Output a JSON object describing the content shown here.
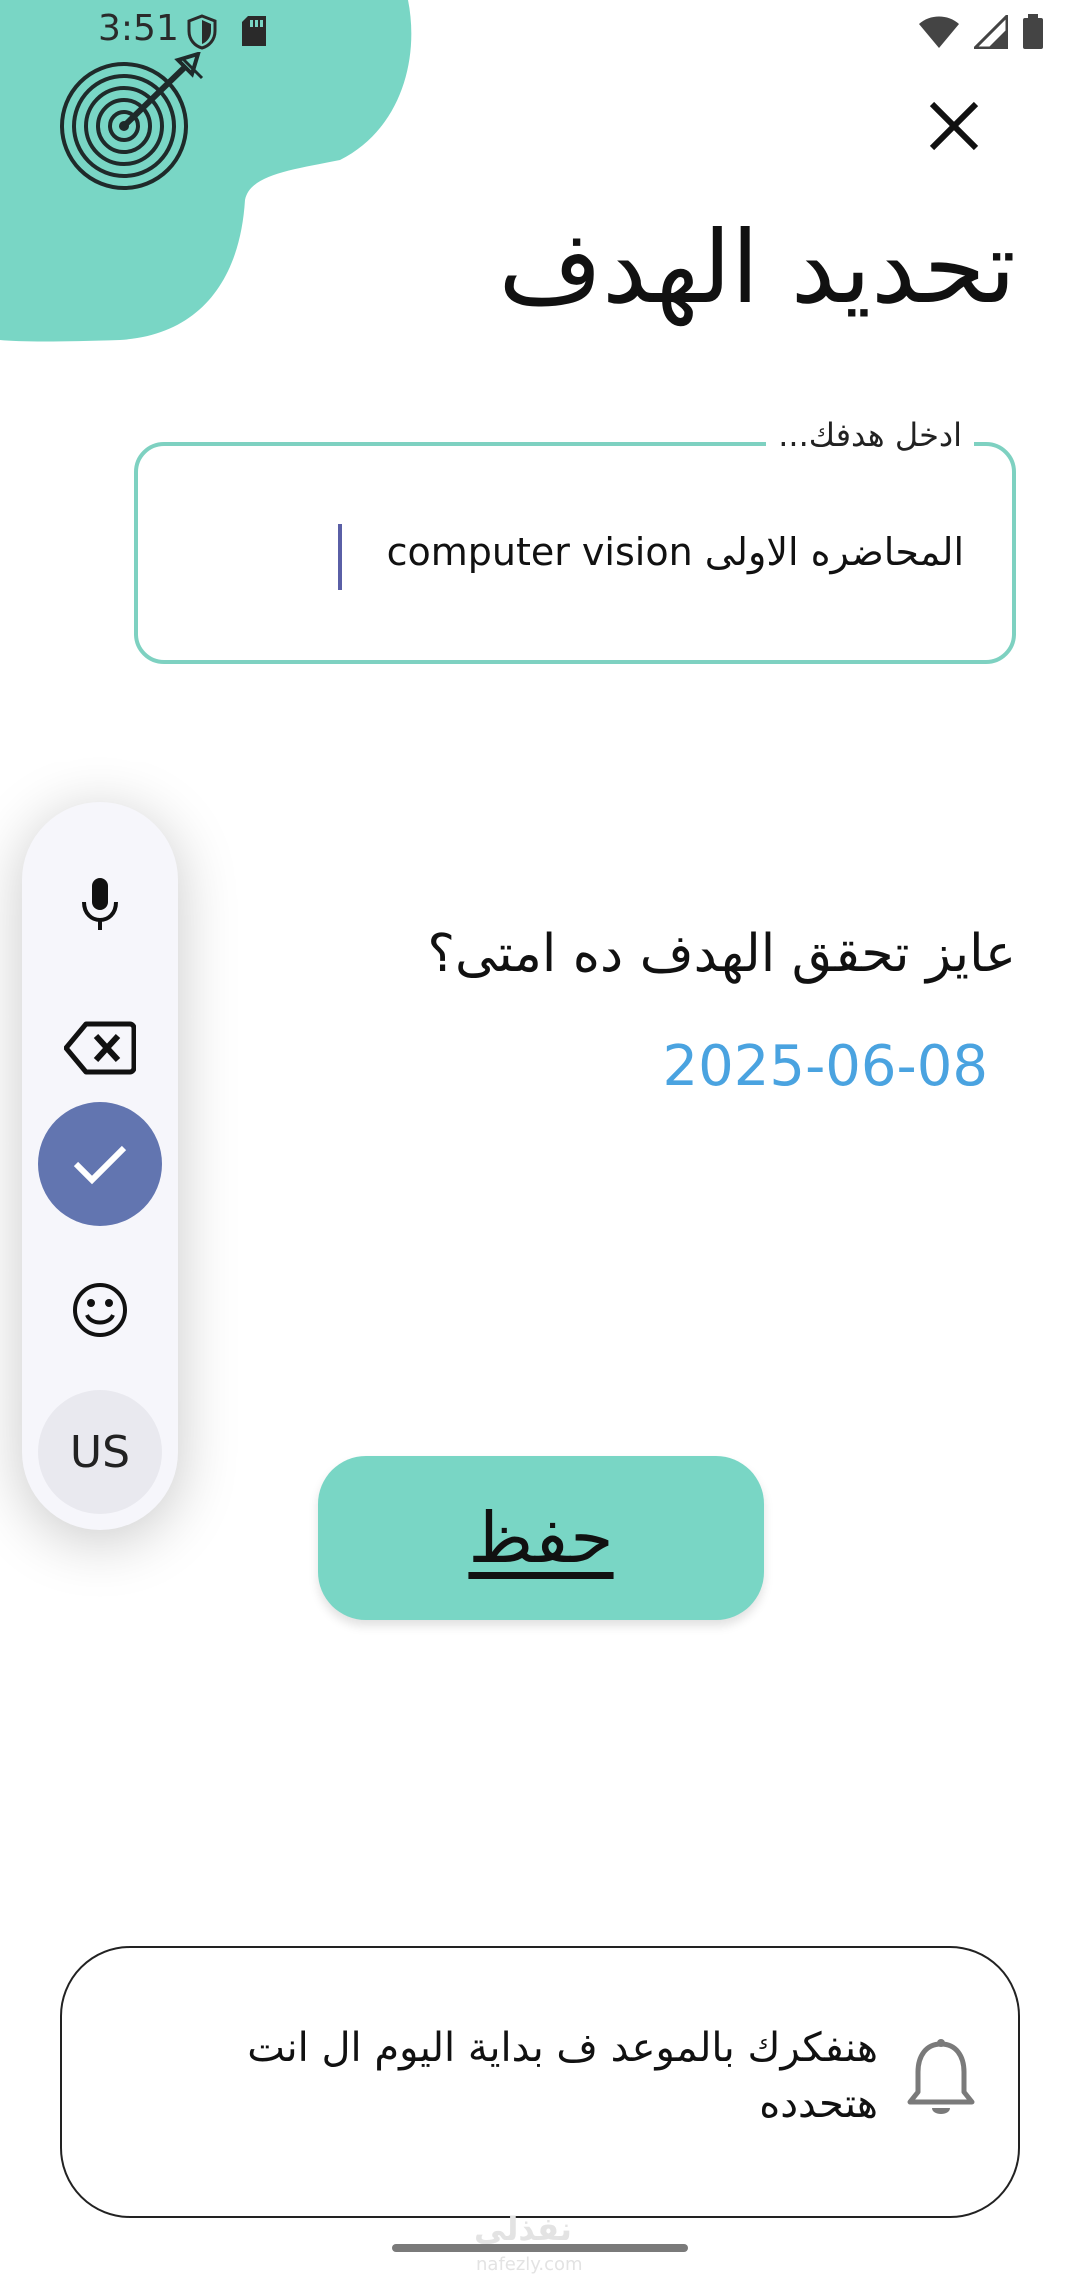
{
  "status_bar": {
    "time": "3:51",
    "left_icons": [
      "shield-icon",
      "sd-card-icon"
    ],
    "right_icons": [
      "wifi-icon",
      "signal-icon",
      "battery-icon"
    ]
  },
  "header": {
    "title": "تحديد الهدف",
    "close_icon": "close-icon",
    "logo_icon": "target-icon"
  },
  "goal_field": {
    "label": "ادخل هدفك...",
    "value": "المحاضره الاولى computer vision"
  },
  "deadline": {
    "question": "عايز تحقق الهدف ده امتى؟",
    "date": "2025-06-08"
  },
  "keyboard_toolbar": {
    "items": [
      "mic-icon",
      "backspace-icon",
      "check-icon",
      "emoji-icon"
    ],
    "language": "US"
  },
  "save_button": {
    "label": "حفظ"
  },
  "reminder": {
    "text": "هنفكرك بالموعد ف بداية اليوم ال انت هتحدده",
    "icon": "bell-icon"
  },
  "watermark": {
    "arabic": "نفذلي",
    "url": "nafezly.com"
  },
  "colors": {
    "accent": "#79d6c5",
    "field_border": "#7ed1c1",
    "date": "#4aa3e0",
    "keyboard_check": "#6275b0"
  }
}
